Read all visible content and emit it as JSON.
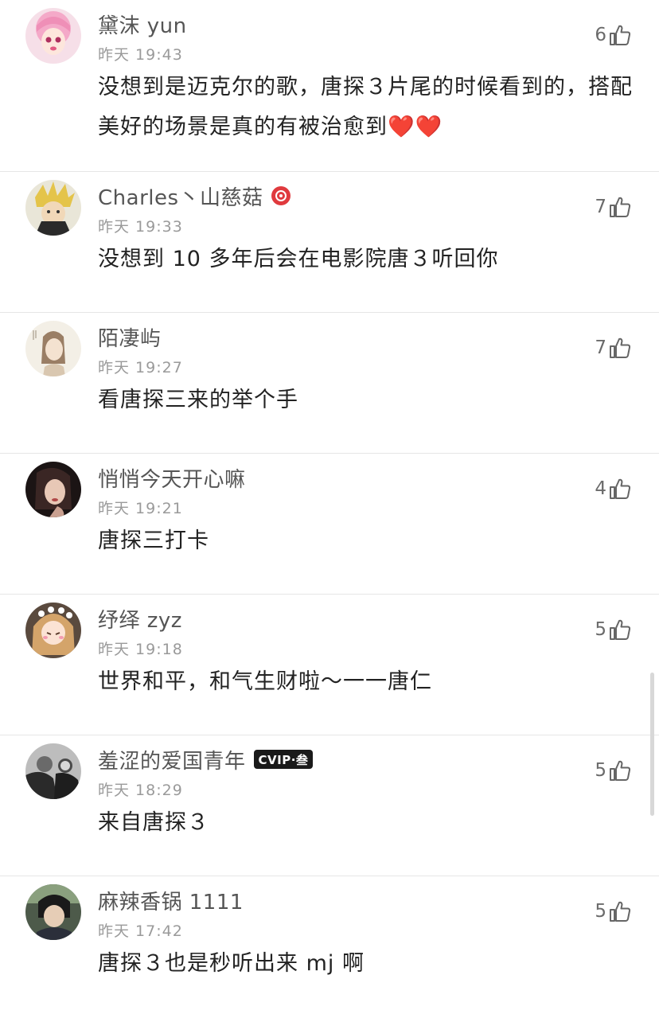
{
  "comments": [
    {
      "username": "黛沫 yun",
      "time": "昨天 19:43",
      "likes": "6",
      "text": "没想到是迈克尔的歌，唐探３片尾的时候看到的，搭配美好的场景是真的有被治愈到❤️❤️",
      "avatar": "pink-anime-girl-avatar"
    },
    {
      "username": "Charles丶山慈菇",
      "time": "昨天 19:33",
      "likes": "7",
      "text": "没想到 10 多年后会在电影院唐３听回你",
      "avatar": "anime-character-avatar",
      "badge": "music-badge"
    },
    {
      "username": "陌凄屿",
      "time": "昨天 19:27",
      "likes": "7",
      "text": "看唐探三来的举个手",
      "avatar": "ink-painting-girl-avatar"
    },
    {
      "username": "悄悄今天开心嘛",
      "time": "昨天 19:21",
      "likes": "4",
      "text": "唐探三打卡",
      "avatar": "dark-portrait-avatar"
    },
    {
      "username": "纾绎 zyz",
      "time": "昨天 19:18",
      "likes": "5",
      "text": "世界和平，和气生财啦～一一唐仁",
      "avatar": "cartoon-girl-avatar"
    },
    {
      "username": "羞涩的爱国青年",
      "time": "昨天 18:29",
      "likes": "5",
      "text": "来自唐探３",
      "avatar": "black-white-photo-avatar",
      "vip_badge": "CVIP·叁"
    },
    {
      "username": "麻辣香锅 1111",
      "time": "昨天 17:42",
      "likes": "5",
      "text": "唐探３也是秒听出来 mj 啊",
      "avatar": "anime-boy-avatar"
    }
  ],
  "colors": {
    "username": "#555555",
    "timestamp": "#9a9a9a",
    "text": "#222222",
    "divider": "#e6e6e6",
    "music_badge": "#e03a3e"
  }
}
